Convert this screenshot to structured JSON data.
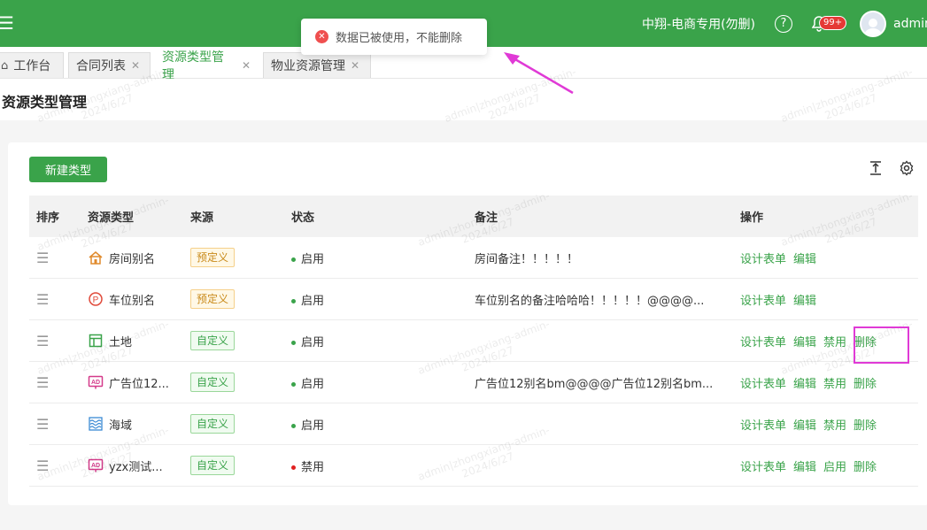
{
  "header": {
    "company": "中翔-电商专用(勿删)",
    "help": "?",
    "badge": "99+",
    "username": "admin"
  },
  "toast": {
    "message": "数据已被使用，不能删除"
  },
  "tabs": [
    {
      "label": "工作台",
      "closable": false,
      "active": false
    },
    {
      "label": "合同列表",
      "closable": true,
      "active": false
    },
    {
      "label": "资源类型管理",
      "closable": true,
      "active": true
    },
    {
      "label": "物业资源管理",
      "closable": true,
      "active": false
    }
  ],
  "page": {
    "title": "资源类型管理"
  },
  "toolbar": {
    "new_label": "新建类型"
  },
  "table": {
    "headers": [
      "排序",
      "资源类型",
      "来源",
      "状态",
      "备注",
      "操作"
    ],
    "rows": [
      {
        "icon": "house-icon",
        "name": "房间别名",
        "source": "预定义",
        "source_type": "pre",
        "status": "启用",
        "status_color": "#3aa34a",
        "note": "房间备注！！！！！",
        "actions": [
          "设计表单",
          "编辑"
        ]
      },
      {
        "icon": "parking-icon",
        "name": "车位别名",
        "source": "预定义",
        "source_type": "pre",
        "status": "启用",
        "status_color": "#3aa34a",
        "note": "车位别名的备注哈哈哈！！！！！@@@@...",
        "actions": [
          "设计表单",
          "编辑"
        ]
      },
      {
        "icon": "layout-icon",
        "name": "土地",
        "source": "自定义",
        "source_type": "custom",
        "status": "启用",
        "status_color": "#3aa34a",
        "note": "",
        "actions": [
          "设计表单",
          "编辑",
          "禁用",
          "删除"
        ]
      },
      {
        "icon": "ad-icon",
        "name": "广告位12...",
        "source": "自定义",
        "source_type": "custom",
        "status": "启用",
        "status_color": "#3aa34a",
        "note": "广告位12别名bm@@@@广告位12别名bm...",
        "actions": [
          "设计表单",
          "编辑",
          "禁用",
          "删除"
        ]
      },
      {
        "icon": "waves-icon",
        "name": "海域",
        "source": "自定义",
        "source_type": "custom",
        "status": "启用",
        "status_color": "#3aa34a",
        "note": "",
        "actions": [
          "设计表单",
          "编辑",
          "禁用",
          "删除"
        ]
      },
      {
        "icon": "ad-icon",
        "name": "yzx测试...",
        "source": "自定义",
        "source_type": "custom",
        "status": "禁用",
        "status_color": "#e02020",
        "note": "",
        "actions": [
          "设计表单",
          "编辑",
          "启用",
          "删除"
        ]
      }
    ]
  },
  "watermark": {
    "line1": "admin|zhongxiang-admin-",
    "line2": "2024/6/27"
  },
  "colors": {
    "primary": "#3aa34a",
    "danger": "#e02020",
    "highlight": "#e03ad6"
  }
}
